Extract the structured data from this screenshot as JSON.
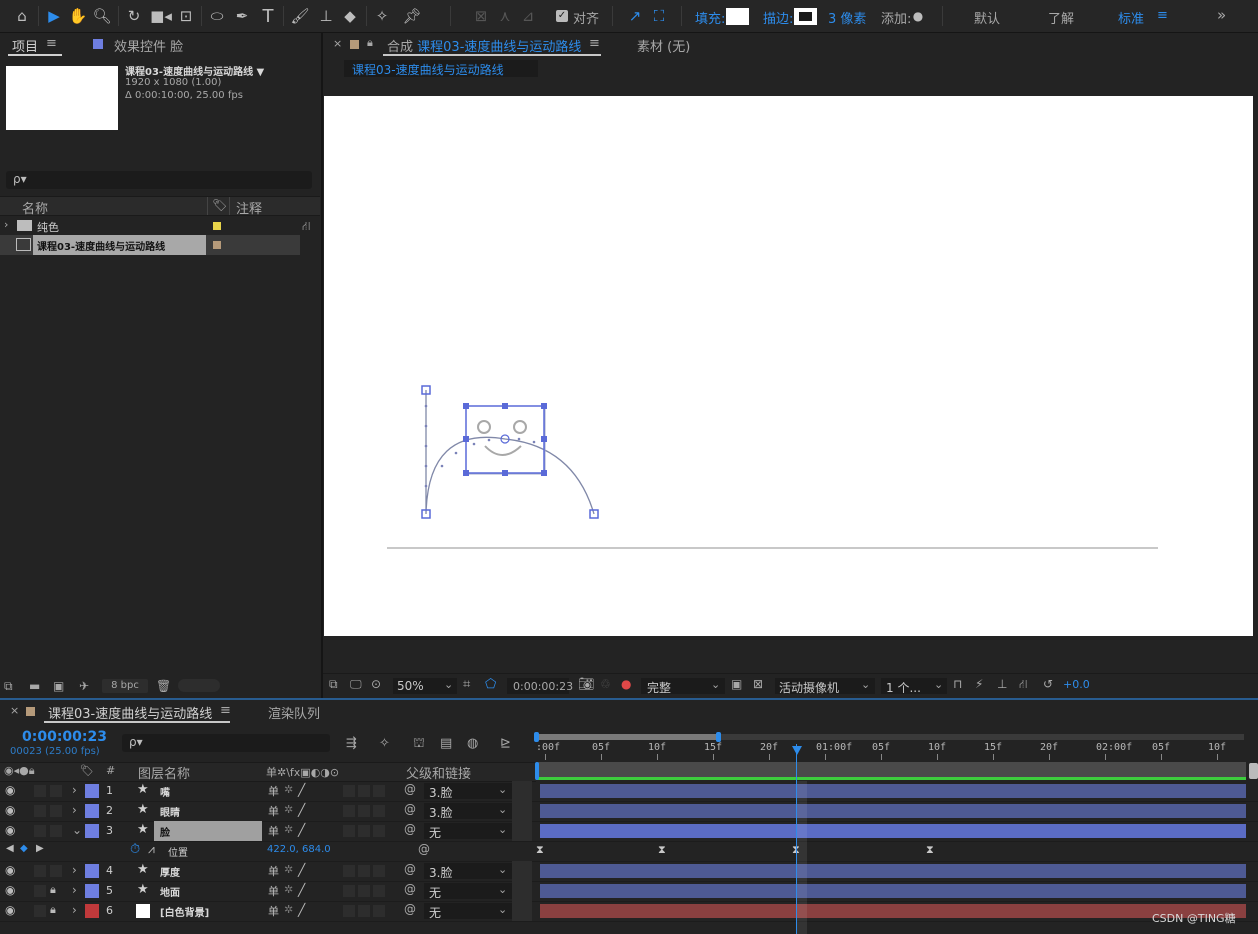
{
  "toolbar": {
    "align_label": "对齐",
    "fill_label": "填充:",
    "stroke_label": "描边:",
    "stroke_px": "3 像素",
    "add_label": "添加:",
    "workspaces": [
      "默认",
      "了解",
      "标准"
    ],
    "more": "»"
  },
  "project": {
    "tab": "项目",
    "effects_tab": "效果控件 脸",
    "comp_name": "课程03-速度曲线与运动路线 ▼",
    "resolution": "1920 x 1080 (1.00)",
    "duration": "Δ 0:00:10:00, 25.00 fps",
    "search_placeholder": "ρ▾",
    "col_name": "名称",
    "col_comment": "注释",
    "items": [
      {
        "name": "纯色",
        "color": "#e8d44a"
      },
      {
        "name": "课程03-速度曲线与运动路线",
        "color": "#b59a7a"
      }
    ],
    "bpc": "8 bpc"
  },
  "comp_viewer": {
    "tab_prefix": "合成",
    "tab_name": "课程03-速度曲线与运动路线",
    "footage_tab": "素材 (无)",
    "breadcrumb": "课程03-速度曲线与运动路线",
    "zoom": "50%",
    "timecode": "0:00:00:23",
    "quality": "完整",
    "camera": "活动摄像机",
    "views": "1 个...",
    "exposure": "+0.0"
  },
  "timeline": {
    "tab_name": "课程03-速度曲线与运动路线",
    "render_tab": "渲染队列",
    "timecode": "0:00:00:23",
    "frames": "00023 (25.00 fps)",
    "search_placeholder": "ρ▾",
    "col_num": "#",
    "col_layer_name": "图层名称",
    "col_switches": "单✲\\fx▣◐◑⊙",
    "col_parent": "父级和链接",
    "ruler": [
      ":00f",
      "05f",
      "10f",
      "15f",
      "20f",
      "01:00f",
      "05f",
      "10f",
      "15f",
      "20f",
      "02:00f",
      "05f",
      "10f"
    ],
    "layers": [
      {
        "num": "1",
        "name": "嘴",
        "color": "#6e7ee0",
        "parent": "3.脸",
        "bar": "#4e5a94",
        "lock": false
      },
      {
        "num": "2",
        "name": "眼睛",
        "color": "#6e7ee0",
        "parent": "3.脸",
        "bar": "#4e5a94",
        "lock": false
      },
      {
        "num": "3",
        "name": "脸",
        "color": "#6e7ee0",
        "parent": "无",
        "bar": "#5b6cc4",
        "lock": false,
        "selected": true
      },
      {
        "num": "4",
        "name": "厚度",
        "color": "#6e7ee0",
        "parent": "3.脸",
        "bar": "#4e5a94",
        "lock": false
      },
      {
        "num": "5",
        "name": "地面",
        "color": "#6e7ee0",
        "parent": "无",
        "bar": "#4e5a94",
        "lock": true
      },
      {
        "num": "6",
        "name": "[白色背景]",
        "color": "#c0393b",
        "parent": "无",
        "bar": "#8a4040",
        "lock": true
      }
    ],
    "property": {
      "name": "位置",
      "value": "422.0, 684.0"
    }
  },
  "watermark": "CSDN @TING糖"
}
